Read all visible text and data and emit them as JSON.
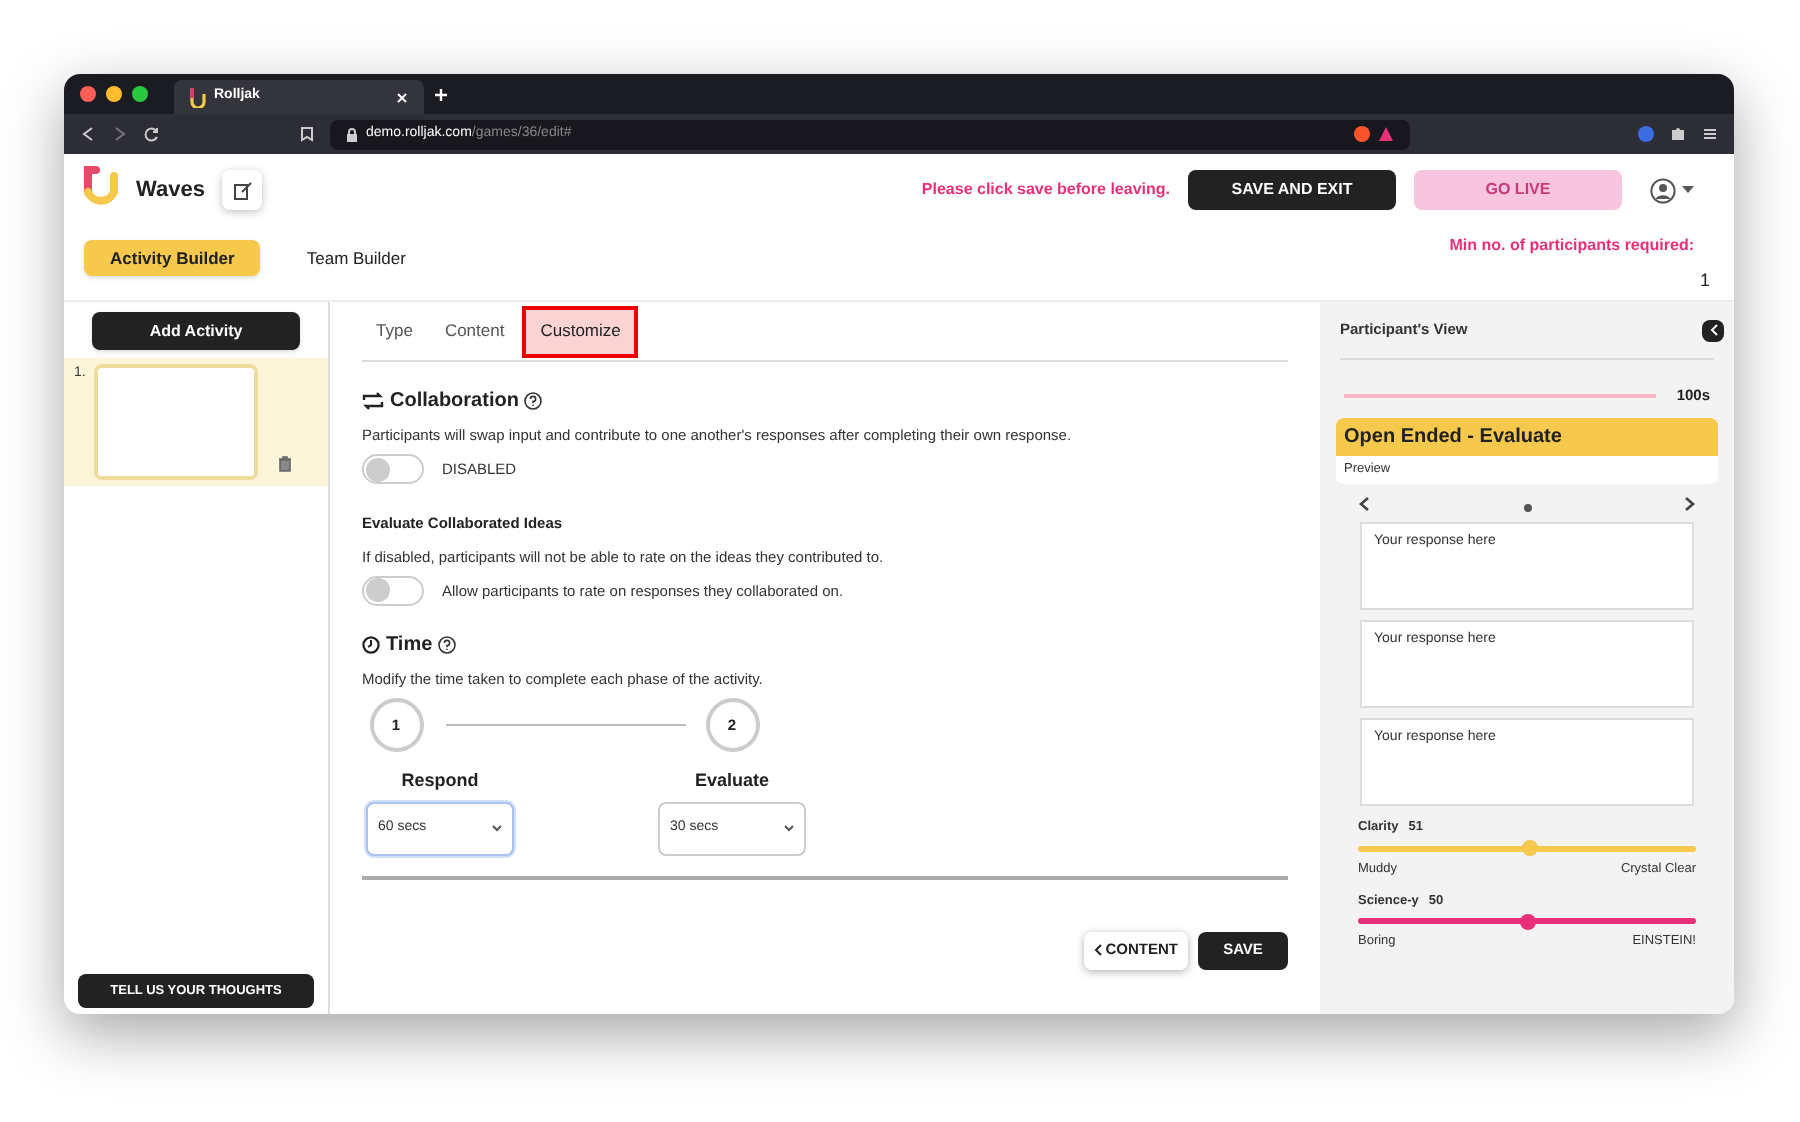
{
  "browser": {
    "tab_title": "Rolljak",
    "url_host": "demo.rolljak.com",
    "url_path": "/games/36/edit#"
  },
  "header": {
    "game_title": "Waves",
    "warning": "Please click save before leaving.",
    "save_exit": "SAVE AND EXIT",
    "go_live": {
      "label": "GO LIVE",
      "disabled": true
    }
  },
  "nav_tabs": [
    {
      "label": "Activity Builder",
      "selected": true
    },
    {
      "label": "Team Builder",
      "selected": false
    }
  ],
  "min_participants": {
    "label": "Min no. of participants required:",
    "value": "1"
  },
  "sidebar": {
    "add_button": "Add Activity",
    "activities": [
      {
        "number": "1.",
        "selected": true
      }
    ],
    "feedback_button": "TELL US YOUR THOUGHTS"
  },
  "editor_tabs": [
    {
      "label": "Type",
      "selected": false
    },
    {
      "label": "Content",
      "selected": false
    },
    {
      "label": "Customize",
      "selected": true
    }
  ],
  "collaboration": {
    "title": "Collaboration",
    "description": "Participants will swap input and contribute to one another's responses after completing their own response.",
    "toggle": {
      "on": false,
      "label": "DISABLED"
    }
  },
  "evaluate": {
    "title": "Evaluate Collaborated Ideas",
    "description": "If disabled, participants will not be able to rate on the ideas they contributed to.",
    "toggle": {
      "on": false,
      "label": "Allow participants to rate on responses they collaborated on."
    }
  },
  "time": {
    "title": "Time",
    "description": "Modify the time taken to complete each phase of the activity.",
    "phases": [
      {
        "step": "1",
        "name": "Respond",
        "value": "60 secs",
        "focused": true
      },
      {
        "step": "2",
        "name": "Evaluate",
        "value": "30 secs",
        "focused": false
      }
    ]
  },
  "footer": {
    "back_button": "CONTENT",
    "save_button": "SAVE"
  },
  "preview": {
    "title": "Participant's View",
    "timer": {
      "level": 1,
      "reading": "100s"
    },
    "card_title": "Open Ended - Evaluate",
    "card_subtitle": "Preview",
    "responses": [
      "Your response here",
      "Your response here",
      "Your response here"
    ],
    "sliders": [
      {
        "name": "Clarity",
        "reading": "51",
        "level": 0.51,
        "color": "#f6c84c",
        "min_label": "Muddy",
        "max_label": "Crystal Clear"
      },
      {
        "name": "Science-y",
        "reading": "50",
        "level": 0.5,
        "color": "#e8307a",
        "min_label": "Boring",
        "max_label": "EINSTEIN!"
      }
    ]
  }
}
